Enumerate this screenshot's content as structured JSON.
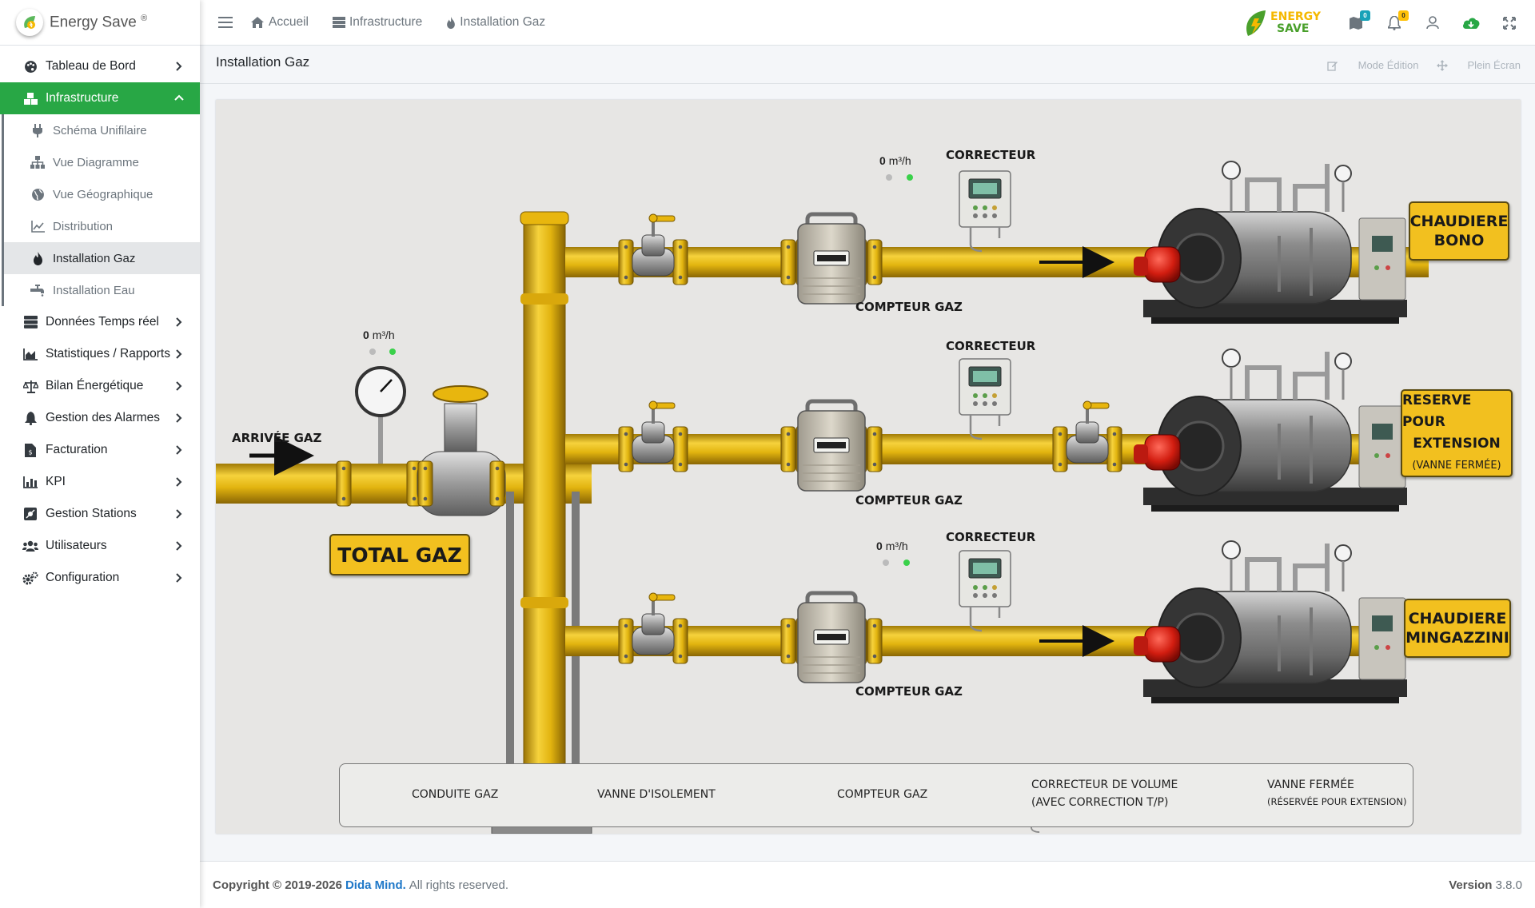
{
  "brand": {
    "name": "Energy Save",
    "reg": "®"
  },
  "topbar": {
    "links": [
      "Accueil",
      "Infrastructure",
      "Installation Gaz"
    ],
    "logo_line1": "ENERGY",
    "logo_line2": "SAVE",
    "badge_msgs": "0",
    "badge_notif": "0"
  },
  "sidebar": {
    "items": [
      {
        "label": "Tableau de Bord",
        "icon": "palette-icon"
      },
      {
        "label": "Infrastructure",
        "icon": "cubes-icon"
      },
      {
        "label": "Données Temps réel",
        "icon": "server-icon"
      },
      {
        "label": "Statistiques / Rapports",
        "icon": "chart-area-icon"
      },
      {
        "label": "Bilan Énergétique",
        "icon": "balance-icon"
      },
      {
        "label": "Gestion des Alarmes",
        "icon": "bell-icon"
      },
      {
        "label": "Facturation",
        "icon": "invoice-icon"
      },
      {
        "label": "KPI",
        "icon": "chart-bar-icon"
      },
      {
        "label": "Gestion Stations",
        "icon": "stations-icon"
      },
      {
        "label": "Utilisateurs",
        "icon": "users-icon"
      },
      {
        "label": "Configuration",
        "icon": "cogs-icon"
      }
    ],
    "sub": [
      {
        "label": "Schéma Unifilaire",
        "icon": "plug-icon"
      },
      {
        "label": "Vue Diagramme",
        "icon": "sitemap-icon"
      },
      {
        "label": "Vue Géographique",
        "icon": "globe-icon"
      },
      {
        "label": "Distribution",
        "icon": "line-chart-icon"
      },
      {
        "label": "Installation Gaz",
        "icon": "fire-icon"
      },
      {
        "label": "Installation Eau",
        "icon": "faucet-icon"
      }
    ]
  },
  "page": {
    "title": "Installation Gaz",
    "mode_edition": "Mode Édition",
    "plein_ecran": "Plein Écran"
  },
  "diagram": {
    "arrivee": "ARRIVÉE GAZ",
    "total": "TOTAL GAZ",
    "flow_value": "0",
    "flow_unit": "m³/h",
    "correcteur": "CORRECTEUR",
    "compteur": "COMPTEUR GAZ",
    "boiler1": [
      "CHAUDIERE",
      "BONO"
    ],
    "boiler2": [
      "RESERVE POUR",
      "EXTENSION",
      "(VANNE FERMÉE)"
    ],
    "boiler3": [
      "CHAUDIERE",
      "MINGAZZINI"
    ]
  },
  "legend": {
    "conduite": "CONDUITE GAZ",
    "vanne": "VANNE D'ISOLEMENT",
    "compteur": "COMPTEUR GAZ",
    "correcteur1": "CORRECTEUR DE VOLUME",
    "correcteur2": "(AVEC CORRECTION T/P)",
    "fermee1": "VANNE FERMÉE",
    "fermee2": "(RÉSERVÉE POUR EXTENSION)"
  },
  "footer": {
    "copyright": "Copyright © 2019-2026",
    "company": "Dida Mind.",
    "rights": "All rights reserved.",
    "version_label": "Version",
    "version": "3.8.0"
  }
}
